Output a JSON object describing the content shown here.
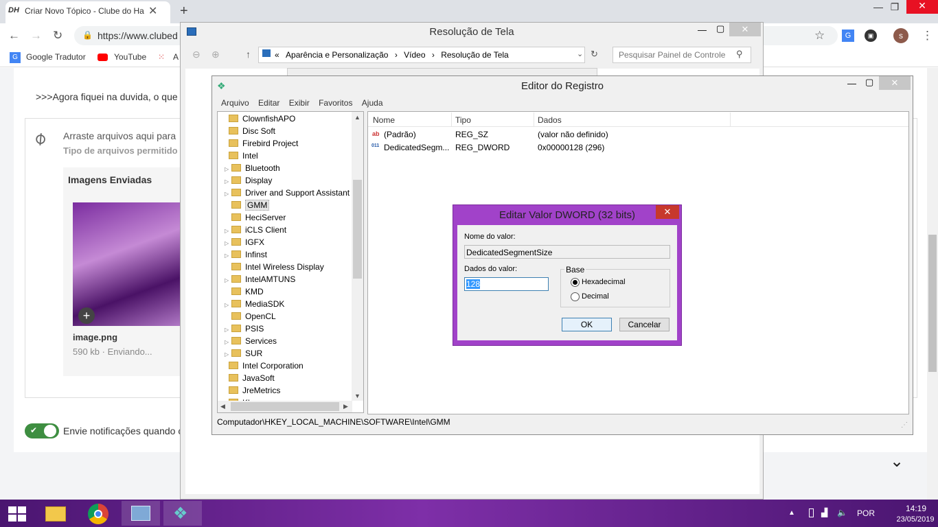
{
  "browser": {
    "tab_icon_text": "DH",
    "tab_title": "Criar Novo Tópico - Clube do Ha",
    "url": "https://www.clubed",
    "bookmarks": [
      {
        "label": "Google Tradutor"
      },
      {
        "label": "YouTube"
      },
      {
        "label": "A"
      }
    ],
    "avatar_letter": "s"
  },
  "page": {
    "question_text": ">>>Agora fiquei na duvida, o que",
    "attach_text": "Arraste arquivos aqui para",
    "attach_types": "Tipo de arquivos permitido",
    "uploads_title": "Imagens Enviadas",
    "image_name": "image.png",
    "image_size": "590 kb · Enviando...",
    "notify_label": "Envie notificações quando c"
  },
  "display_window": {
    "title": "Resolução de Tela",
    "breadcrumb": [
      "«",
      "Aparência e Personalização",
      "Vídeo",
      "Resolução de Tela"
    ],
    "search_placeholder": "Pesquisar Painel de Controle"
  },
  "regedit": {
    "title": "Editor do Registro",
    "menu": [
      "Arquivo",
      "Editar",
      "Exibir",
      "Favoritos",
      "Ajuda"
    ],
    "tree": [
      {
        "label": "ClownfishAPO",
        "level": 0,
        "expander": false
      },
      {
        "label": "Disc Soft",
        "level": 0,
        "expander": false
      },
      {
        "label": "Firebird Project",
        "level": 0,
        "expander": false
      },
      {
        "label": "Intel",
        "level": 0,
        "expander": false
      },
      {
        "label": "Bluetooth",
        "level": 1,
        "expander": true
      },
      {
        "label": "Display",
        "level": 1,
        "expander": true
      },
      {
        "label": "Driver and Support Assistant",
        "level": 1,
        "expander": true
      },
      {
        "label": "GMM",
        "level": 1,
        "expander": false,
        "selected": true
      },
      {
        "label": "HeciServer",
        "level": 1,
        "expander": false
      },
      {
        "label": "iCLS Client",
        "level": 1,
        "expander": true
      },
      {
        "label": "IGFX",
        "level": 1,
        "expander": true
      },
      {
        "label": "Infinst",
        "level": 1,
        "expander": true
      },
      {
        "label": "Intel Wireless Display",
        "level": 1,
        "expander": false
      },
      {
        "label": "IntelAMTUNS",
        "level": 1,
        "expander": true
      },
      {
        "label": "KMD",
        "level": 1,
        "expander": false
      },
      {
        "label": "MediaSDK",
        "level": 1,
        "expander": true
      },
      {
        "label": "OpenCL",
        "level": 1,
        "expander": false
      },
      {
        "label": "PSIS",
        "level": 1,
        "expander": true
      },
      {
        "label": "Services",
        "level": 1,
        "expander": true
      },
      {
        "label": "SUR",
        "level": 1,
        "expander": true
      },
      {
        "label": "Intel Corporation",
        "level": 0,
        "expander": false
      },
      {
        "label": "JavaSoft",
        "level": 0,
        "expander": false
      },
      {
        "label": "JreMetrics",
        "level": 0,
        "expander": false
      },
      {
        "label": "Khronos",
        "level": 0,
        "expander": false
      }
    ],
    "columns": [
      "Nome",
      "Tipo",
      "Dados"
    ],
    "values": [
      {
        "name": "(Padrão)",
        "type": "REG_SZ",
        "data": "(valor não definido)",
        "icon": "ab"
      },
      {
        "name": "DedicatedSegm...",
        "type": "REG_DWORD",
        "data": "0x00000128 (296)",
        "icon": "011"
      }
    ],
    "status": "Computador\\HKEY_LOCAL_MACHINE\\SOFTWARE\\Intel\\GMM"
  },
  "dialog": {
    "title": "Editar Valor DWORD (32 bits)",
    "name_label": "Nome do valor:",
    "name_value": "DedicatedSegmentSize",
    "data_label": "Dados do valor:",
    "data_value": "128",
    "base_label": "Base",
    "radio_hex": "Hexadecimal",
    "radio_dec": "Decimal",
    "selected_base": "Hexadecimal",
    "ok": "OK",
    "cancel": "Cancelar"
  },
  "taskbar": {
    "lang": "POR",
    "time": "14:19",
    "date": "23/05/2019"
  }
}
